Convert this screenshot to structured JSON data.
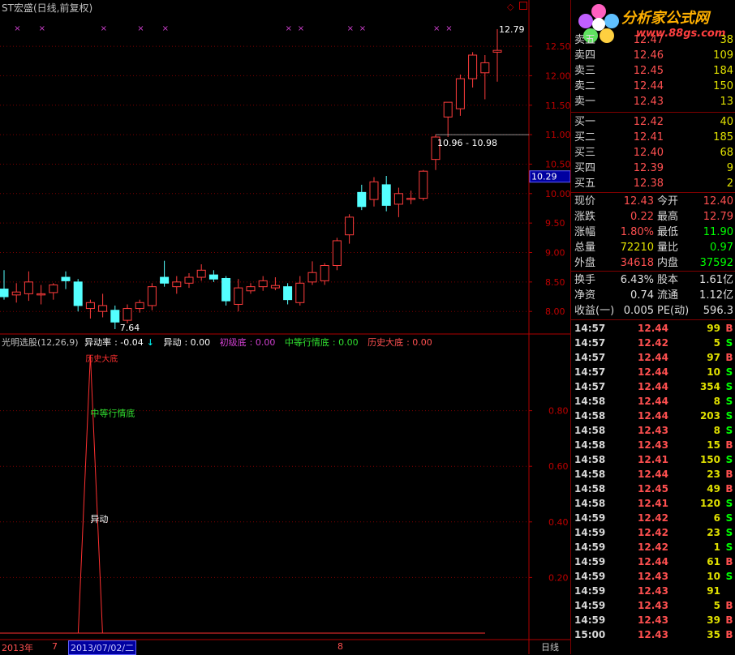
{
  "title": "ST宏盛(日线,前复权)",
  "colors": {
    "up": "#ff3c3c",
    "down": "#54ffff",
    "grid": "#800000",
    "axis": "#b00000",
    "bg": "#000000"
  },
  "main_axis": {
    "labels": [
      "12.50",
      "12.00",
      "11.50",
      "11.00",
      "10.50",
      "10.00",
      "9.50",
      "9.00",
      "8.50",
      "8.00"
    ],
    "current_price_tag": "10.29"
  },
  "annotations": {
    "high_label": "12.79",
    "low_label": "7.64",
    "range_label": "10.96 - 10.98"
  },
  "chart_data": {
    "type": "candlestick",
    "ylim": [
      7.7,
      12.9
    ],
    "candles": [
      {
        "o": 8.38,
        "h": 8.7,
        "l": 8.2,
        "c": 8.25
      },
      {
        "o": 8.28,
        "h": 8.48,
        "l": 8.15,
        "c": 8.33
      },
      {
        "o": 8.3,
        "h": 8.68,
        "l": 8.18,
        "c": 8.5
      },
      {
        "o": 8.28,
        "h": 8.45,
        "l": 8.12,
        "c": 8.3
      },
      {
        "o": 8.32,
        "h": 8.48,
        "l": 8.2,
        "c": 8.45
      },
      {
        "o": 8.58,
        "h": 8.68,
        "l": 8.38,
        "c": 8.52
      },
      {
        "o": 8.5,
        "h": 8.55,
        "l": 8.0,
        "c": 8.1
      },
      {
        "o": 8.05,
        "h": 8.2,
        "l": 7.88,
        "c": 8.15
      },
      {
        "o": 8.0,
        "h": 8.3,
        "l": 7.9,
        "c": 8.1
      },
      {
        "o": 8.02,
        "h": 8.1,
        "l": 7.7,
        "c": 7.82
      },
      {
        "o": 7.85,
        "h": 8.12,
        "l": 7.8,
        "c": 8.05
      },
      {
        "o": 8.05,
        "h": 8.2,
        "l": 7.98,
        "c": 8.15
      },
      {
        "o": 8.1,
        "h": 8.48,
        "l": 8.02,
        "c": 8.42
      },
      {
        "o": 8.58,
        "h": 8.86,
        "l": 8.42,
        "c": 8.48
      },
      {
        "o": 8.42,
        "h": 8.6,
        "l": 8.3,
        "c": 8.5
      },
      {
        "o": 8.48,
        "h": 8.65,
        "l": 8.4,
        "c": 8.58
      },
      {
        "o": 8.58,
        "h": 8.8,
        "l": 8.52,
        "c": 8.7
      },
      {
        "o": 8.62,
        "h": 8.7,
        "l": 8.5,
        "c": 8.55
      },
      {
        "o": 8.56,
        "h": 8.6,
        "l": 8.1,
        "c": 8.18
      },
      {
        "o": 8.12,
        "h": 8.55,
        "l": 8.0,
        "c": 8.4
      },
      {
        "o": 8.35,
        "h": 8.48,
        "l": 8.3,
        "c": 8.42
      },
      {
        "o": 8.42,
        "h": 8.6,
        "l": 8.35,
        "c": 8.52
      },
      {
        "o": 8.4,
        "h": 8.58,
        "l": 8.36,
        "c": 8.44
      },
      {
        "o": 8.42,
        "h": 8.48,
        "l": 8.12,
        "c": 8.2
      },
      {
        "o": 8.15,
        "h": 8.6,
        "l": 8.1,
        "c": 8.48
      },
      {
        "o": 8.5,
        "h": 8.85,
        "l": 8.45,
        "c": 8.66
      },
      {
        "o": 8.52,
        "h": 8.82,
        "l": 8.45,
        "c": 8.78
      },
      {
        "o": 8.78,
        "h": 9.25,
        "l": 8.7,
        "c": 9.2
      },
      {
        "o": 9.3,
        "h": 9.65,
        "l": 9.15,
        "c": 9.6
      },
      {
        "o": 10.02,
        "h": 10.15,
        "l": 9.72,
        "c": 9.78
      },
      {
        "o": 9.9,
        "h": 10.28,
        "l": 9.78,
        "c": 10.2
      },
      {
        "o": 10.15,
        "h": 10.3,
        "l": 9.7,
        "c": 9.8
      },
      {
        "o": 9.82,
        "h": 10.1,
        "l": 9.6,
        "c": 10.0
      },
      {
        "o": 9.9,
        "h": 10.05,
        "l": 9.82,
        "c": 9.92
      },
      {
        "o": 9.92,
        "h": 10.4,
        "l": 9.88,
        "c": 10.38
      },
      {
        "o": 10.58,
        "h": 11.0,
        "l": 10.4,
        "c": 10.96
      },
      {
        "o": 11.3,
        "h": 11.55,
        "l": 10.96,
        "c": 11.55
      },
      {
        "o": 11.44,
        "h": 12.02,
        "l": 11.32,
        "c": 11.95
      },
      {
        "o": 11.95,
        "h": 12.4,
        "l": 11.8,
        "c": 12.35
      },
      {
        "o": 12.05,
        "h": 12.35,
        "l": 11.6,
        "c": 12.22
      },
      {
        "o": 12.4,
        "h": 12.79,
        "l": 11.9,
        "c": 12.43
      }
    ],
    "markers_x_index": [
      1,
      3,
      8,
      11,
      13,
      23,
      24,
      28,
      29,
      35,
      36
    ],
    "indicator": {
      "name": "光明选股(12,26,9)",
      "series": [
        {
          "name": "异动率",
          "value": "-0.04",
          "color": "#ffffff"
        },
        {
          "name": "异动",
          "value": "0.00",
          "color": "#ffffff"
        },
        {
          "name": "初级底",
          "value": "0.00",
          "color": "#d040d0"
        },
        {
          "name": "中等行情底",
          "value": "0.00",
          "color": "#30e030"
        },
        {
          "name": "历史大底",
          "value": "0.00",
          "color": "#ff5050"
        }
      ],
      "ylim": [
        0,
        1
      ],
      "axis_labels": [
        "0.80",
        "0.60",
        "0.40",
        "0.20"
      ],
      "spike_index": 7,
      "spike_labels": {
        "top": "历史大底",
        "mid": "中等行情底",
        "low": "异动"
      }
    }
  },
  "bottom_bar": {
    "year": "2013年",
    "month1": "7",
    "date_box": "2013/07/02/二",
    "month2": "8",
    "period": "日线"
  },
  "logo": {
    "text": "分析家公式网",
    "url": "www.88gs.com"
  },
  "order_book": {
    "asks": [
      {
        "label": "卖五",
        "price": "12.47",
        "vol": "38"
      },
      {
        "label": "卖四",
        "price": "12.46",
        "vol": "109"
      },
      {
        "label": "卖三",
        "price": "12.45",
        "vol": "184"
      },
      {
        "label": "卖二",
        "price": "12.44",
        "vol": "150"
      },
      {
        "label": "卖一",
        "price": "12.43",
        "vol": "13"
      }
    ],
    "bids": [
      {
        "label": "买一",
        "price": "12.42",
        "vol": "40"
      },
      {
        "label": "买二",
        "price": "12.41",
        "vol": "185"
      },
      {
        "label": "买三",
        "price": "12.40",
        "vol": "68"
      },
      {
        "label": "买四",
        "price": "12.39",
        "vol": "9"
      },
      {
        "label": "买五",
        "price": "12.38",
        "vol": "2"
      }
    ]
  },
  "quote": [
    {
      "l1": "现价",
      "v1": "12.43",
      "c1": "red",
      "l2": "今开",
      "v2": "12.40",
      "c2": "red"
    },
    {
      "l1": "涨跌",
      "v1": "0.22",
      "c1": "red",
      "l2": "最高",
      "v2": "12.79",
      "c2": "red"
    },
    {
      "l1": "涨幅",
      "v1": "1.80%",
      "c1": "red",
      "l2": "最低",
      "v2": "11.90",
      "c2": "green"
    },
    {
      "l1": "总量",
      "v1": "72210",
      "c1": "yellow",
      "l2": "量比",
      "v2": "0.97",
      "c2": "green"
    },
    {
      "l1": "外盘",
      "v1": "34618",
      "c1": "red",
      "l2": "内盘",
      "v2": "37592",
      "c2": "green"
    },
    {
      "l1": "换手",
      "v1": "6.43%",
      "c1": "white",
      "l2": "股本",
      "v2": "1.61亿",
      "c2": "white"
    },
    {
      "l1": "净资",
      "v1": "0.74",
      "c1": "white",
      "l2": "流通",
      "v2": "1.12亿",
      "c2": "white"
    },
    {
      "l1": "收益(一)",
      "v1": "0.005",
      "c1": "white",
      "l2": "PE(动)",
      "v2": "596.3",
      "c2": "white"
    }
  ],
  "ticks": [
    {
      "t": "14:57",
      "p": "12.44",
      "v": "99",
      "s": "B"
    },
    {
      "t": "14:57",
      "p": "12.42",
      "v": "5",
      "s": "S"
    },
    {
      "t": "14:57",
      "p": "12.44",
      "v": "97",
      "s": "B"
    },
    {
      "t": "14:57",
      "p": "12.44",
      "v": "10",
      "s": "S"
    },
    {
      "t": "14:57",
      "p": "12.44",
      "v": "354",
      "s": "S"
    },
    {
      "t": "14:58",
      "p": "12.44",
      "v": "8",
      "s": "S"
    },
    {
      "t": "14:58",
      "p": "12.44",
      "v": "203",
      "s": "S"
    },
    {
      "t": "14:58",
      "p": "12.43",
      "v": "8",
      "s": "S"
    },
    {
      "t": "14:58",
      "p": "12.43",
      "v": "15",
      "s": "B"
    },
    {
      "t": "14:58",
      "p": "12.41",
      "v": "150",
      "s": "S"
    },
    {
      "t": "14:58",
      "p": "12.44",
      "v": "23",
      "s": "B"
    },
    {
      "t": "14:58",
      "p": "12.45",
      "v": "49",
      "s": "B"
    },
    {
      "t": "14:58",
      "p": "12.41",
      "v": "120",
      "s": "S"
    },
    {
      "t": "14:59",
      "p": "12.42",
      "v": "6",
      "s": "S"
    },
    {
      "t": "14:59",
      "p": "12.42",
      "v": "23",
      "s": "S"
    },
    {
      "t": "14:59",
      "p": "12.42",
      "v": "1",
      "s": "S"
    },
    {
      "t": "14:59",
      "p": "12.44",
      "v": "61",
      "s": "B"
    },
    {
      "t": "14:59",
      "p": "12.43",
      "v": "10",
      "s": "S"
    },
    {
      "t": "14:59",
      "p": "12.43",
      "v": "91",
      "s": ""
    },
    {
      "t": "14:59",
      "p": "12.43",
      "v": "5",
      "s": "B"
    },
    {
      "t": "14:59",
      "p": "12.43",
      "v": "39",
      "s": "B"
    },
    {
      "t": "15:00",
      "p": "12.43",
      "v": "35",
      "s": "B"
    }
  ]
}
